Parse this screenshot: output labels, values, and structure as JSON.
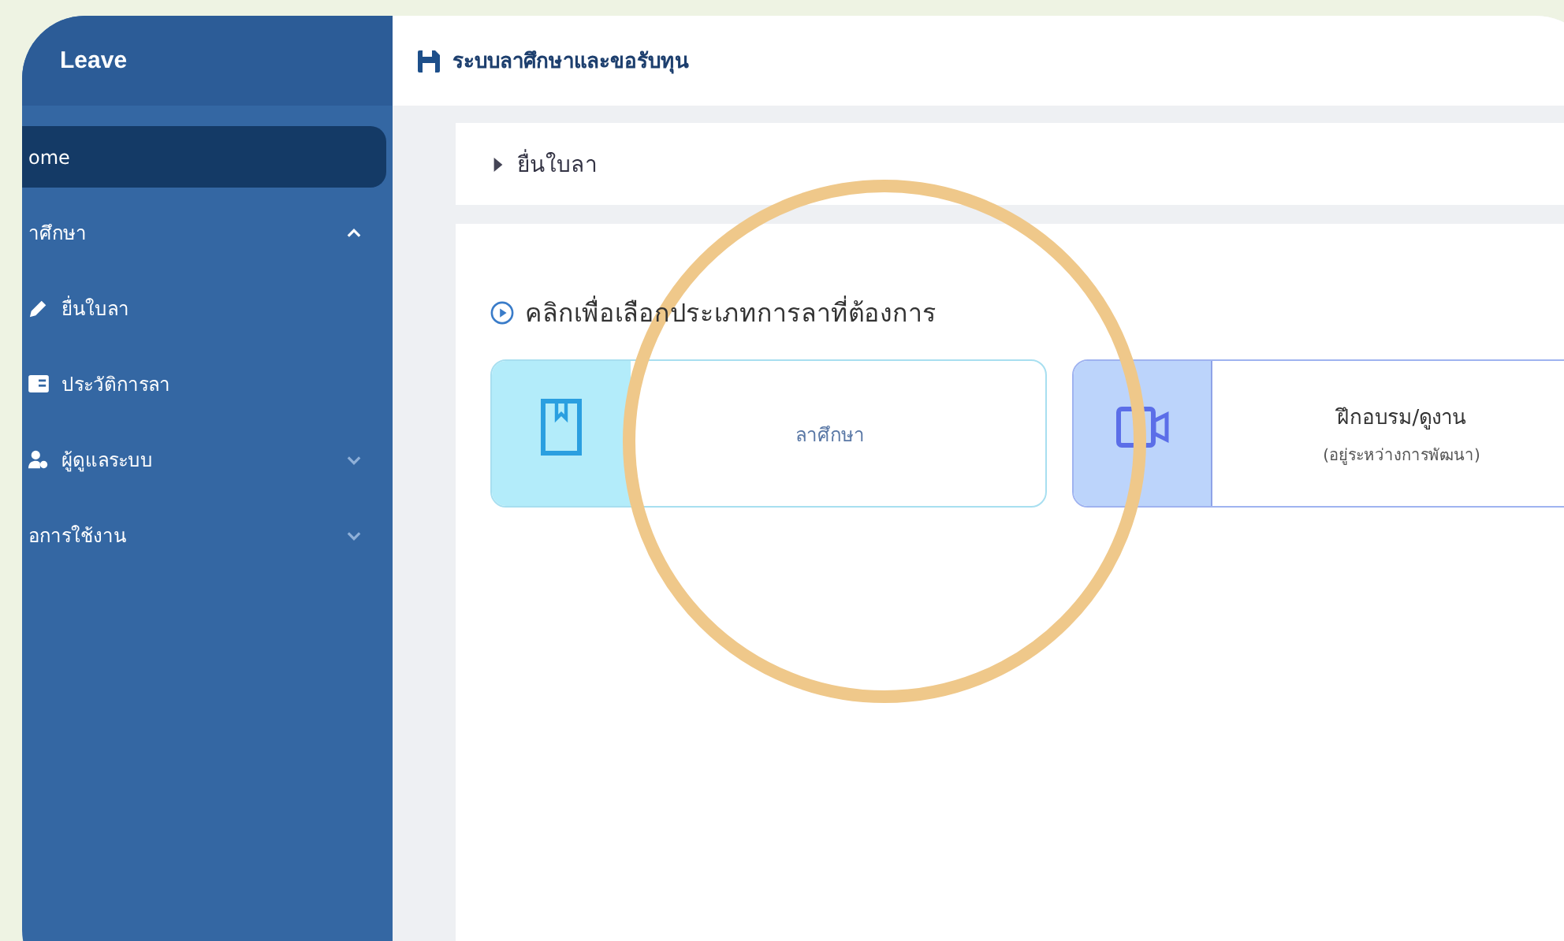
{
  "sidebar": {
    "brand": "Leave",
    "items": [
      {
        "label": "ome",
        "selected": true
      },
      {
        "label": "าศึกษา",
        "selected": false,
        "expanded": true,
        "children": [
          {
            "label": "ยื่นใบลา",
            "selected": false,
            "kind": "edit"
          },
          {
            "label": "ประวัติการลา",
            "selected": false,
            "kind": "card"
          }
        ]
      },
      {
        "label": "ผู้ดูแลระบบ",
        "selected": false,
        "expanded": false,
        "kind": "admin"
      },
      {
        "label": "อการใช้งาน",
        "selected": false,
        "expanded": false
      }
    ]
  },
  "header": {
    "title": "ระบบลาศึกษาและขอรับทุน"
  },
  "breadcrumb": {
    "label": "ยื่นใบลา"
  },
  "panel": {
    "heading": "คลิกเพื่อเลือกประเภทการลาที่ต้องการ",
    "options": [
      {
        "kind": "book",
        "label": "ลาศึกษา",
        "color": "#b3ecfa"
      },
      {
        "kind": "video",
        "label": "ฝึกอบรม/ดูงาน",
        "note": "(อยู่ระหว่างการพัฒนา)",
        "color": "#bcd4fb"
      }
    ]
  }
}
